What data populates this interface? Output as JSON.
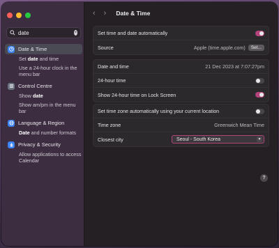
{
  "search": {
    "value": "date"
  },
  "sidebar": {
    "sections": [
      {
        "label": "Date & Time",
        "icon": "clock-icon",
        "icon_color": "#3b82f6",
        "items": [
          {
            "pre": "Set ",
            "bold": "date",
            "post": " and time"
          },
          {
            "pre": "Use a 24-hour clock in the menu bar",
            "bold": "",
            "post": ""
          }
        ]
      },
      {
        "label": "Control Centre",
        "icon": "control-centre-icon",
        "icon_color": "#6b7280",
        "items": [
          {
            "pre": "Show ",
            "bold": "date",
            "post": ""
          },
          {
            "pre": "Show am/pm in the menu bar",
            "bold": "",
            "post": ""
          }
        ]
      },
      {
        "label": "Language & Region",
        "icon": "globe-icon",
        "icon_color": "#3b82f6",
        "items": [
          {
            "pre": "",
            "bold": "Date",
            "post": " and number formats"
          }
        ]
      },
      {
        "label": "Privacy & Security",
        "icon": "hand-icon",
        "icon_color": "#3b82f6",
        "items": [
          {
            "pre": "Allow applications to access Calendar",
            "bold": "",
            "post": ""
          }
        ]
      }
    ]
  },
  "header": {
    "back": "‹",
    "forward": "›",
    "title": "Date & Time"
  },
  "group1": {
    "auto_label": "Set time and date automatically",
    "source_label": "Source",
    "source_value": "Apple (time.apple.com)",
    "set_button": "Set..."
  },
  "group2": {
    "datetime_label": "Date and time",
    "datetime_value": "21 Dec 2023 at 7:07:27pm",
    "hour24_label": "24-hour time",
    "lock_label": "Show 24-hour time on Lock Screen"
  },
  "group3": {
    "tz_auto_label": "Set time zone automatically using your current location",
    "tz_label": "Time zone",
    "tz_value": "Greenwich Mean Time",
    "city_label": "Closest city",
    "city_value": "Seoul - South Korea"
  },
  "help": "?",
  "colors": {
    "accent": "#b2447a"
  }
}
